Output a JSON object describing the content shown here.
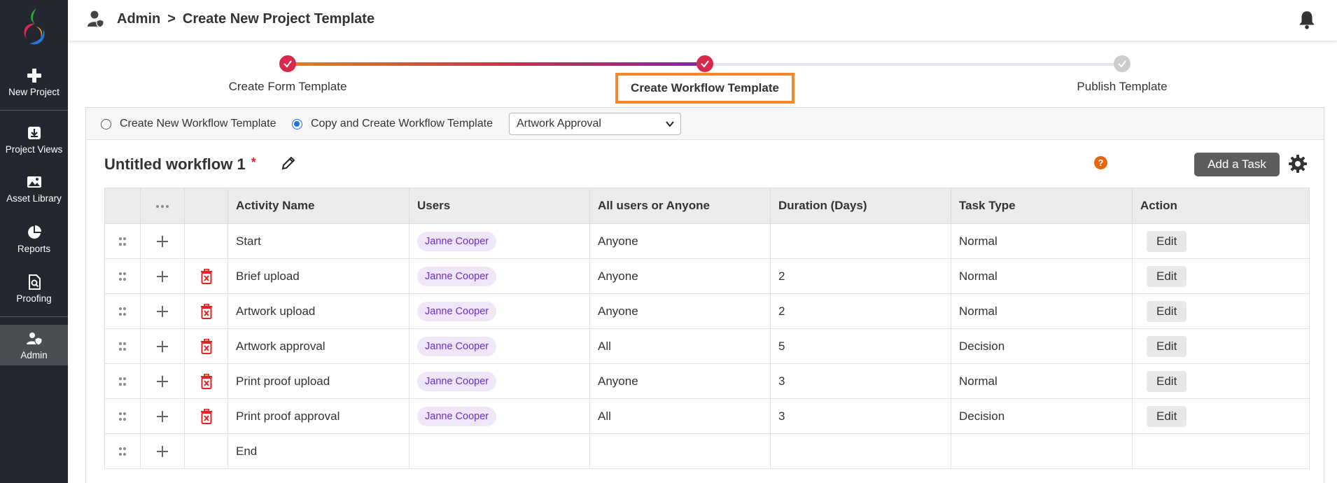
{
  "sidebar": {
    "items": [
      {
        "label": "New Project",
        "icon": "plus-icon"
      },
      {
        "label": "Project Views",
        "icon": "download-box-icon"
      },
      {
        "label": "Asset Library",
        "icon": "image-icon"
      },
      {
        "label": "Reports",
        "icon": "pie-chart-icon"
      },
      {
        "label": "Proofing",
        "icon": "document-search-icon"
      },
      {
        "label": "Admin",
        "icon": "user-shield-icon"
      }
    ],
    "active": "Admin"
  },
  "header": {
    "crumb_root": "Admin",
    "crumb_sep": ">",
    "crumb_current": "Create New Project Template"
  },
  "stepper": {
    "steps": [
      {
        "label": "Create Form Template",
        "status": "done"
      },
      {
        "label": "Create Workflow Template",
        "status": "active"
      },
      {
        "label": "Publish Template",
        "status": "pending"
      }
    ]
  },
  "options": {
    "radio_new": "Create New Workflow Template",
    "radio_copy": "Copy and Create Workflow Template",
    "selected_radio": "copy",
    "select_value": "Artwork Approval"
  },
  "workflow": {
    "title": "Untitled workflow 1",
    "required_mark": "*",
    "help_label": "?",
    "add_task_label": "Add a Task"
  },
  "table": {
    "columns": [
      "Activity Name",
      "Users",
      "All users or Anyone",
      "Duration (Days)",
      "Task Type",
      "Action"
    ],
    "rows": [
      {
        "activity": "Start",
        "user": "Janne Cooper",
        "all": "Anyone",
        "duration": "",
        "type": "Normal",
        "action": "Edit",
        "deletable": false
      },
      {
        "activity": "Brief upload",
        "user": "Janne Cooper",
        "all": "Anyone",
        "duration": "2",
        "type": "Normal",
        "action": "Edit",
        "deletable": true
      },
      {
        "activity": "Artwork upload",
        "user": "Janne Cooper",
        "all": "Anyone",
        "duration": "2",
        "type": "Normal",
        "action": "Edit",
        "deletable": true
      },
      {
        "activity": "Artwork approval",
        "user": "Janne Cooper",
        "all": "All",
        "duration": "5",
        "type": "Decision",
        "action": "Edit",
        "deletable": true
      },
      {
        "activity": "Print proof upload",
        "user": "Janne Cooper",
        "all": "Anyone",
        "duration": "3",
        "type": "Normal",
        "action": "Edit",
        "deletable": true
      },
      {
        "activity": "Print proof approval",
        "user": "Janne Cooper",
        "all": "All",
        "duration": "3",
        "type": "Decision",
        "action": "Edit",
        "deletable": true
      },
      {
        "activity": "End",
        "user": "",
        "all": "",
        "duration": "",
        "type": "",
        "action": "",
        "deletable": false
      }
    ]
  },
  "colors": {
    "sidebar_bg": "#232830",
    "step_done": "#d6294d",
    "step_pending": "#cccccc",
    "active_step_border": "#f0882e",
    "delete_red": "#e02424",
    "pill_text": "#6a2fc9"
  }
}
